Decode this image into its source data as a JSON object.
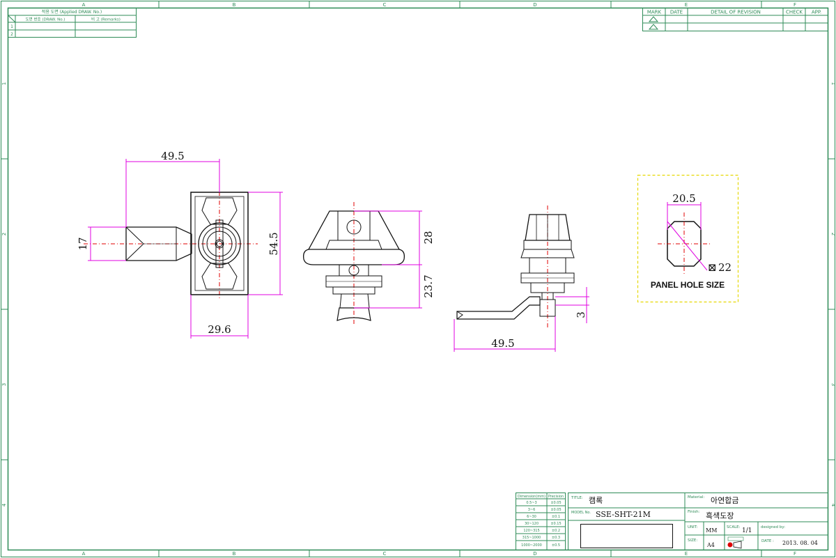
{
  "frame": {
    "zones_x": [
      "A",
      "B",
      "C",
      "D",
      "E",
      "F"
    ],
    "zones_y": [
      "1",
      "2",
      "3",
      "4"
    ]
  },
  "applied_table": {
    "title": "적용 도면 (Applied DRAW. No.)",
    "col_draw": "도면 번호 (DRAW. No.)",
    "col_remarks": "비 고 (Remarks)",
    "rows": [
      "1",
      "2"
    ]
  },
  "revision_table": {
    "headers": [
      "MARK",
      "DATE",
      "DETAIL OF REVISION",
      "CHECK",
      "APP."
    ]
  },
  "dimensions": {
    "front_lever_length": "49.5",
    "front_lever_width": "17",
    "front_body_height": "54.5",
    "front_body_width": "29.6",
    "side_upper_height": "28",
    "side_lower_height": "23.7",
    "lever_view_length": "49.5",
    "lever_offset": "3",
    "hole_width": "20.5",
    "hole_square": "22"
  },
  "panel_hole": {
    "label": "PANEL HOLE SIZE",
    "square_symbol": "⊠"
  },
  "tolerance_table": {
    "headers": [
      "Dimension(mm)",
      "Precision"
    ],
    "rows": [
      [
        "0.5~3",
        "±0.05"
      ],
      [
        "3~6",
        "±0.05"
      ],
      [
        "6~30",
        "±0.1"
      ],
      [
        "30~120",
        "±0.15"
      ],
      [
        "120~315",
        "±0.2"
      ],
      [
        "315~1000",
        "±0.3"
      ],
      [
        "1000~2000",
        "±0.5"
      ]
    ]
  },
  "title_block": {
    "title_label": "TITLE:",
    "title_value": "캠록",
    "model_label": "MODEL No.",
    "model_value": "SSE-SHT-21M",
    "material_label": "Material:",
    "material_value": "아연합금",
    "finish_label": "Finish:",
    "finish_value": "흑색도장",
    "unit_label": "UNIT:",
    "unit_value": "MM",
    "scale_label": "SCALE:",
    "scale_value": "1/1",
    "size_label": "SIZE:",
    "size_value": "A4",
    "designed_label": "designed by:",
    "date_label": "DATE :",
    "date_value": "2013. 08. 04"
  },
  "colors": {
    "frame": "#2e8b57",
    "dimension": "#e000e0",
    "centerline": "#e00000",
    "outline": "#111111",
    "panel_box": "#e6d800"
  }
}
